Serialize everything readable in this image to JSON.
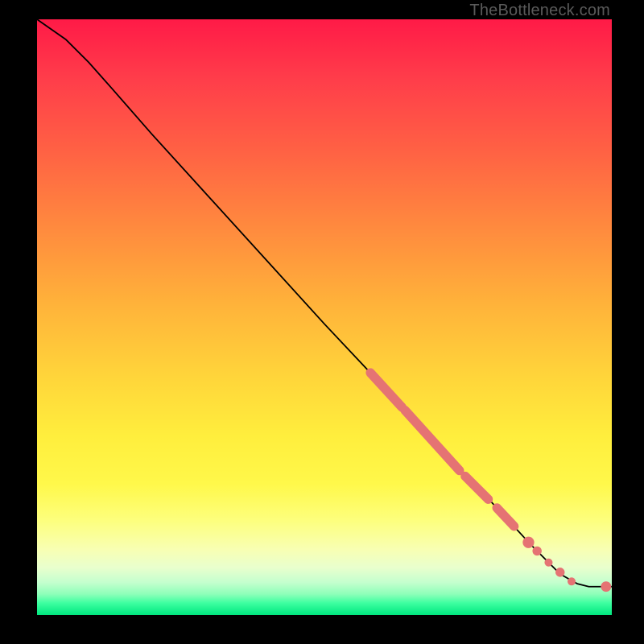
{
  "watermark": "TheBottleneck.com",
  "chart_data": {
    "type": "line",
    "title": "",
    "xlabel": "",
    "ylabel": "",
    "xlim": [
      0,
      100
    ],
    "ylim": [
      0,
      100
    ],
    "grid": false,
    "curve": [
      {
        "x": 0.0,
        "y": 100.0
      },
      {
        "x": 5.0,
        "y": 96.5
      },
      {
        "x": 9.0,
        "y": 92.5
      },
      {
        "x": 13.0,
        "y": 88.0
      },
      {
        "x": 20.0,
        "y": 80.0
      },
      {
        "x": 30.0,
        "y": 69.0
      },
      {
        "x": 40.0,
        "y": 58.0
      },
      {
        "x": 50.0,
        "y": 47.0
      },
      {
        "x": 58.0,
        "y": 38.5
      },
      {
        "x": 65.0,
        "y": 31.0
      },
      {
        "x": 72.0,
        "y": 23.5
      },
      {
        "x": 80.0,
        "y": 15.0
      },
      {
        "x": 86.0,
        "y": 8.5
      },
      {
        "x": 91.0,
        "y": 3.5
      },
      {
        "x": 94.0,
        "y": 1.8
      },
      {
        "x": 96.0,
        "y": 1.3
      },
      {
        "x": 98.0,
        "y": 1.3
      },
      {
        "x": 100.0,
        "y": 1.3
      }
    ],
    "marker_segments": [
      {
        "x1": 58.0,
        "y1": 38.5,
        "x2": 63.5,
        "y2": 32.5
      },
      {
        "x1": 64.0,
        "y1": 32.0,
        "x2": 73.5,
        "y2": 21.5
      },
      {
        "x1": 74.5,
        "y1": 20.5,
        "x2": 78.5,
        "y2": 16.5
      },
      {
        "x1": 80.0,
        "y1": 15.0,
        "x2": 83.0,
        "y2": 11.8
      }
    ],
    "marker_points": [
      {
        "x": 85.5,
        "y": 9.0,
        "r": 1.0
      },
      {
        "x": 87.0,
        "y": 7.5,
        "r": 0.8
      },
      {
        "x": 89.0,
        "y": 5.5,
        "r": 0.7
      },
      {
        "x": 91.0,
        "y": 3.8,
        "r": 0.8
      },
      {
        "x": 93.0,
        "y": 2.2,
        "r": 0.7
      },
      {
        "x": 99.0,
        "y": 1.3,
        "r": 0.9
      }
    ],
    "marker_color": "#e57373",
    "line_color": "#000000"
  }
}
